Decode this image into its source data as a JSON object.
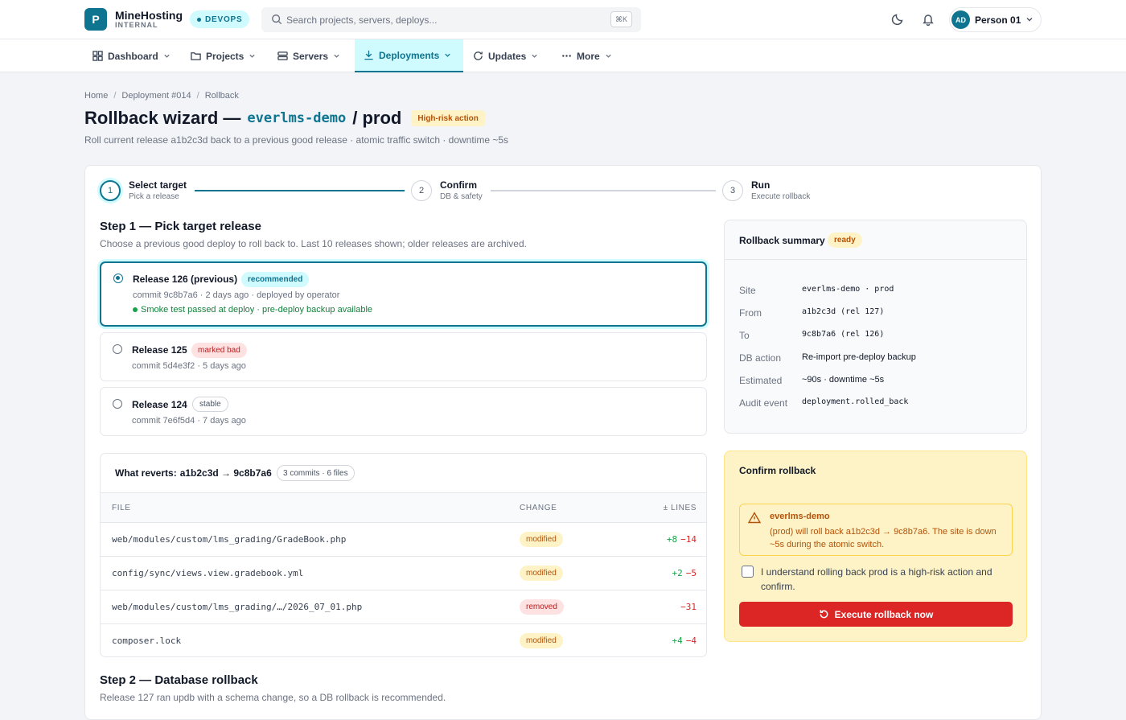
{
  "brand": {
    "logo_letter": "P",
    "name": "MineHosting",
    "subtitle": "INTERNAL",
    "env_badge": "DEVOPS"
  },
  "search": {
    "placeholder": "Search projects, servers, deploys...",
    "shortcut": "⌘K"
  },
  "user": {
    "initials": "AD",
    "name": "Person 01"
  },
  "nav": [
    {
      "label": "Dashboard",
      "icon": "grid-icon"
    },
    {
      "label": "Projects",
      "icon": "folder-icon"
    },
    {
      "label": "Servers",
      "icon": "server-icon"
    },
    {
      "label": "Deployments",
      "icon": "download-icon",
      "active": true
    },
    {
      "label": "Updates",
      "icon": "refresh-icon"
    },
    {
      "label": "More",
      "icon": "dots-icon"
    }
  ],
  "breadcrumb": [
    "Home",
    "Deployment #014",
    "Rollback"
  ],
  "header": {
    "title_prefix": "Rollback wizard —",
    "slug": "everlms-demo",
    "title_suffix": "/ prod",
    "risk_badge": "High-risk action",
    "subtitle": "Roll current release a1b2c3d back to a previous good release · atomic traffic switch · downtime ~5s"
  },
  "stepper": [
    {
      "num": "1",
      "name": "Select target",
      "desc": "Pick a release"
    },
    {
      "num": "2",
      "name": "Confirm",
      "desc": "DB & safety"
    },
    {
      "num": "3",
      "name": "Run",
      "desc": "Execute rollback"
    }
  ],
  "step1": {
    "title": "Step 1 — Pick target release",
    "desc": "Choose a previous good deploy to roll back to. Last 10 releases shown; older releases are archived."
  },
  "releases": [
    {
      "name": "Release 126 (previous)",
      "badge": "recommended",
      "meta": "commit 9c8b7a6 · 2 days ago · deployed by operator",
      "ok": "Smoke test passed at deploy · pre-deploy backup available"
    },
    {
      "name": "Release 125",
      "badge": "marked bad",
      "meta": "commit 5d4e3f2 · 5 days ago"
    },
    {
      "name": "Release 124",
      "badge": "stable",
      "meta": "commit 7e6f5d4 · 7 days ago"
    }
  ],
  "diff": {
    "title_prefix": "What reverts:",
    "title_range": "a1b2c3d → 9c8b7a6",
    "count": "3 commits · 6 files",
    "headers": {
      "file": "FILE",
      "change": "CHANGE",
      "lines": "± LINES"
    },
    "rows": [
      {
        "file": "web/modules/custom/lms_grading/GradeBook.php",
        "change": "modified",
        "add": "+8",
        "del": "−14"
      },
      {
        "file": "config/sync/views.view.gradebook.yml",
        "change": "modified",
        "add": "+2",
        "del": "−5"
      },
      {
        "file": "web/modules/custom/lms_grading/…/2026_07_01.php",
        "change": "removed",
        "add": "",
        "del": "−31"
      },
      {
        "file": "composer.lock",
        "change": "modified",
        "add": "+4",
        "del": "−4"
      }
    ]
  },
  "step2": {
    "title": "Step 2 — Database rollback",
    "desc": "Release 127 ran updb with a schema change, so a DB rollback is recommended."
  },
  "summary": {
    "title": "Rollback summary",
    "badge": "ready",
    "rows": [
      {
        "key": "Site",
        "value": "everlms-demo · prod",
        "mono": true
      },
      {
        "key": "From",
        "value": "a1b2c3d (rel 127)",
        "mono": true
      },
      {
        "key": "To",
        "value": "9c8b7a6 (rel 126)",
        "mono": true
      },
      {
        "key": "DB action",
        "value": "Re-import pre-deploy backup",
        "mono": false
      },
      {
        "key": "Estimated",
        "value": "~90s · downtime ~5s",
        "mono": false
      },
      {
        "key": "Audit event",
        "value": "deployment.rolled_back",
        "mono": true
      }
    ]
  },
  "confirm": {
    "title": "Confirm rollback",
    "warning_title": "everlms-demo",
    "warning_text": "(prod) will roll back a1b2c3d → 9c8b7a6. The site is down ~5s during the atomic switch.",
    "checkbox_label": "I understand rolling back prod is a high-risk action and confirm.",
    "button": "Execute rollback now"
  },
  "colors": {
    "accent": "#0e7490",
    "accent_soft": "#cffafe",
    "danger": "#dc2626",
    "warning_bg": "#fef3c7",
    "success": "#16a34a"
  }
}
